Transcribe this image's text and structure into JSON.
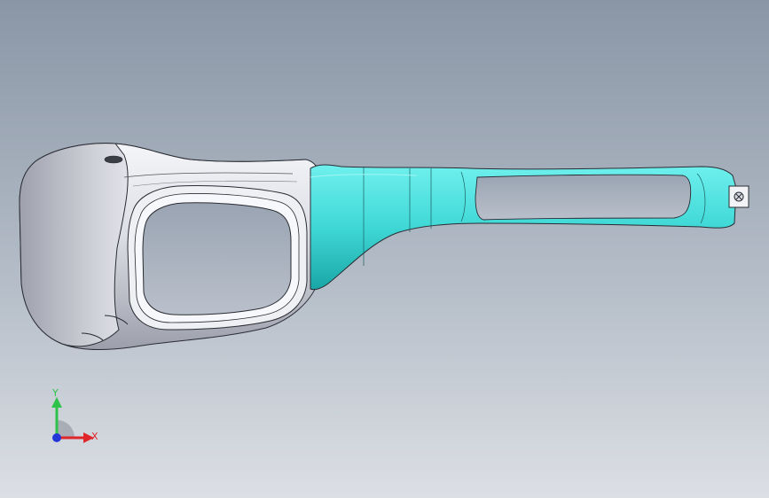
{
  "viewport": {
    "background_top": "#8a96a6",
    "background_bottom": "#d9dde3",
    "model": {
      "frame_color": "#e4e6ec",
      "frame_shadow": "#8f92a0",
      "temple_color": "#3fd8d6",
      "temple_dark": "#1aa6a6",
      "edge_color": "#2a2c33"
    }
  },
  "triad": {
    "y_label": "Y",
    "x_label": "X",
    "y_color": "#2ec24a",
    "x_color": "#e0262a",
    "z_color": "#2438d8"
  }
}
